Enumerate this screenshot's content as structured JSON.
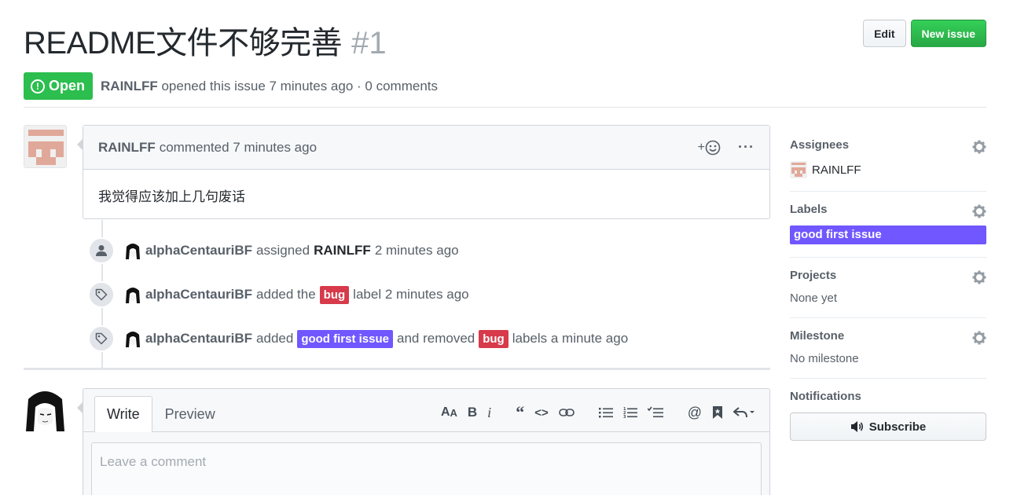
{
  "issue": {
    "title": "README文件不够完善",
    "number": "#1",
    "state": "Open",
    "author": "RAINLFF",
    "opened_text": "opened this issue 7 minutes ago · 0 comments"
  },
  "header_actions": {
    "edit_label": "Edit",
    "new_issue_label": "New issue"
  },
  "comment": {
    "author": "RAINLFF",
    "time_text": "commented 7 minutes ago",
    "reaction_icon": "smiley-icon",
    "body": "我觉得应该加上几句废话"
  },
  "events": [
    {
      "icon": "person-icon",
      "actor": "alphaCentauriBF",
      "text_before": "assigned",
      "target": "RAINLFF",
      "text_after": "2 minutes ago"
    },
    {
      "icon": "tag-icon",
      "actor": "alphaCentauriBF",
      "text_before": "added the",
      "label": "bug",
      "text_after": "label 2 minutes ago"
    },
    {
      "icon": "tag-icon",
      "actor": "alphaCentauriBF",
      "text_before": "added",
      "label": "good first issue",
      "text_middle": "and removed",
      "label2": "bug",
      "text_after": "labels a minute ago"
    }
  ],
  "new_comment": {
    "tab_write": "Write",
    "tab_preview": "Preview",
    "placeholder": "Leave a comment"
  },
  "sidebar": {
    "assignees_title": "Assignees",
    "assignee": "RAINLFF",
    "labels_title": "Labels",
    "label": "good first issue",
    "projects_title": "Projects",
    "projects_value": "None yet",
    "milestone_title": "Milestone",
    "milestone_value": "No milestone",
    "notifications_title": "Notifications",
    "subscribe_label": "Subscribe"
  },
  "colors": {
    "open_green": "#2cbe4e",
    "new_issue_green": "#28a745",
    "bug_red": "#d73a4a",
    "good_first_issue_purple": "#7057ff",
    "identicon": "#e0a899"
  }
}
